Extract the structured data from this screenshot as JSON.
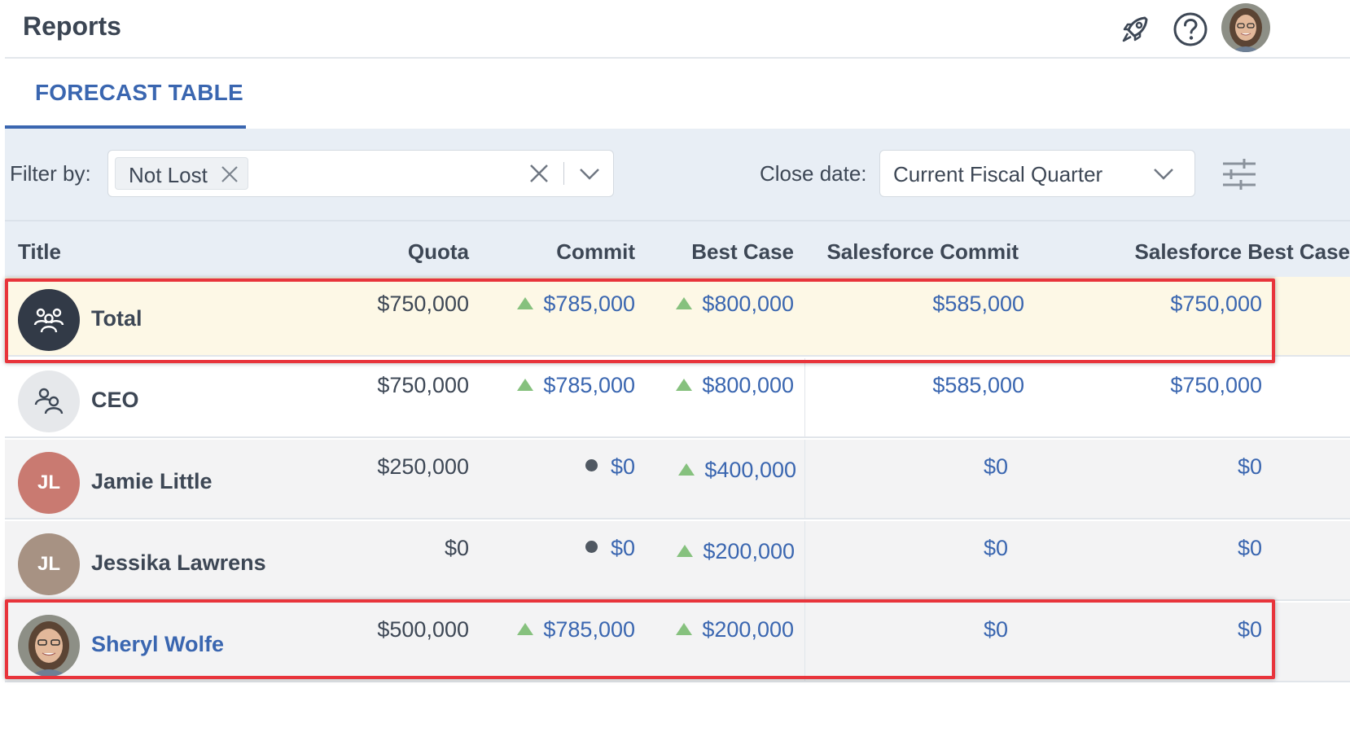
{
  "header": {
    "title": "Reports",
    "icons": [
      "rocket-icon",
      "help-circle-icon",
      "user-avatar"
    ]
  },
  "tabs": [
    {
      "label": "FORECAST TABLE",
      "active": true
    }
  ],
  "filters": {
    "filter_by_label": "Filter by:",
    "chips": [
      {
        "label": "Not Lost"
      }
    ],
    "close_date_label": "Close date:",
    "close_date_value": "Current Fiscal Quarter"
  },
  "table": {
    "columns": [
      "Title",
      "Quota",
      "Commit",
      "Best Case",
      "Salesforce Commit",
      "Salesforce Best Case"
    ],
    "rows": [
      {
        "name": "Total",
        "avatar": "group-icon",
        "quota": "$750,000",
        "commit": "$785,000",
        "commit_marker": "up-triangle",
        "best_case": "$800,000",
        "best_marker": "up-triangle",
        "sf_commit": "$585,000",
        "sf_best": "$750,000",
        "highlighted": true
      },
      {
        "name": "CEO",
        "avatar": "role-icon",
        "quota": "$750,000",
        "commit": "$785,000",
        "commit_marker": "up-triangle",
        "best_case": "$800,000",
        "best_marker": "up-triangle",
        "sf_commit": "$585,000",
        "sf_best": "$750,000"
      },
      {
        "name": "Jamie Little",
        "avatar_initials": "JL",
        "quota": "$250,000",
        "commit": "$0",
        "commit_marker": "dot",
        "best_case": "$400,000",
        "best_marker": "up-triangle",
        "sf_commit": "$0",
        "sf_best": "$0"
      },
      {
        "name": "Jessika Lawrens",
        "avatar_initials": "JL",
        "quota": "$0",
        "commit": "$0",
        "commit_marker": "dot",
        "best_case": "$200,000",
        "best_marker": "up-triangle",
        "sf_commit": "$0",
        "sf_best": "$0"
      },
      {
        "name": "Sheryl Wolfe",
        "avatar": "user-photo",
        "quota": "$500,000",
        "commit": "$785,000",
        "commit_marker": "up-triangle",
        "best_case": "$200,000",
        "best_marker": "up-triangle",
        "sf_commit": "$0",
        "sf_best": "$0",
        "highlighted": true
      }
    ]
  },
  "colors": {
    "accent": "#3a66b0",
    "positive_marker": "#86c17e",
    "highlight_border": "#e8343b",
    "total_row_bg": "#fdf8e6"
  }
}
